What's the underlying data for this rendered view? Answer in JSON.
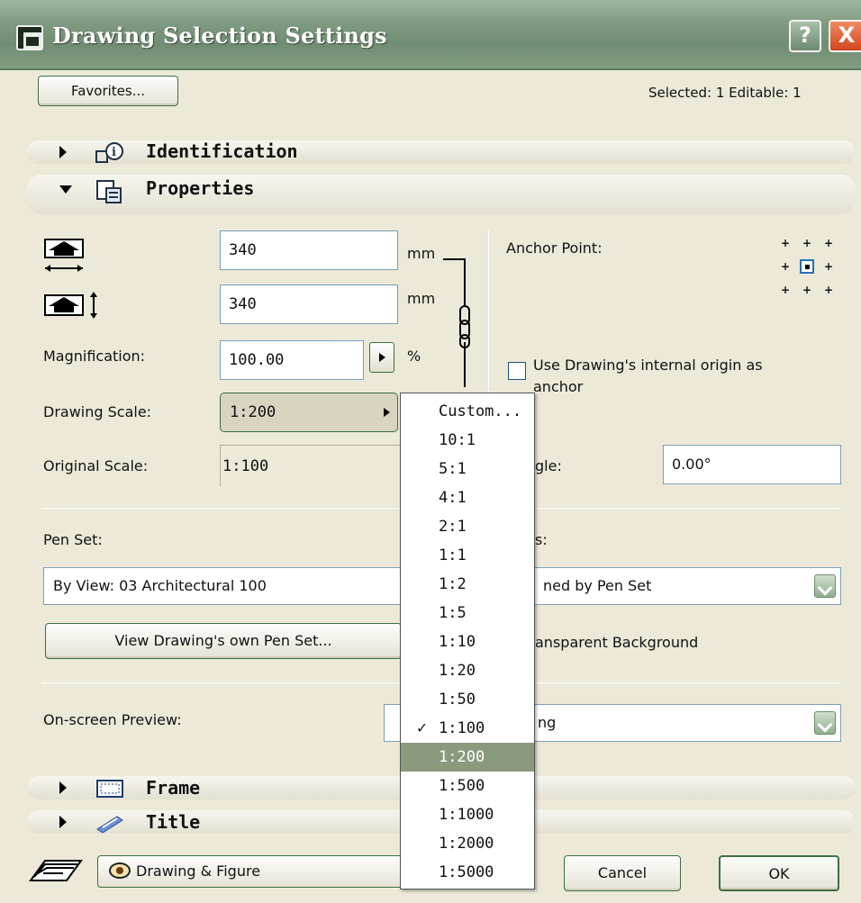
{
  "window": {
    "title": "Drawing Selection Settings",
    "help_label": "?",
    "close_label": "X"
  },
  "toolbar": {
    "favorites_label": "Favorites...",
    "selected_info": "Selected: 1 Editable: 1"
  },
  "sections": {
    "identification": "Identification",
    "properties": "Properties",
    "frame": "Frame",
    "title": "Title"
  },
  "properties": {
    "width_value": "340",
    "width_unit": "mm",
    "height_value": "340",
    "height_unit": "mm",
    "magnification_label": "Magnification:",
    "magnification_value": "100.00",
    "magnification_unit": "%",
    "drawing_scale_label": "Drawing Scale:",
    "drawing_scale_value": "1:200",
    "original_scale_label": "Original Scale:",
    "original_scale_value": "1:100",
    "anchor_point_label": "Anchor Point:",
    "use_origin_label_line1": "Use Drawing's internal origin as",
    "use_origin_label_line2": "anchor",
    "angle_label_partial": "gle:",
    "angle_value": "0.00°",
    "pen_set_label": "Pen Set:",
    "pen_set_value": "By View: 03 Architectural 100",
    "view_pen_set_button": "View Drawing's own Pen Set...",
    "colors_label_partial": "s:",
    "colors_value_partial": "ned by Pen Set",
    "transparent_bg_partial": "ansparent Background",
    "preview_label": "On-screen Preview:",
    "preview_value_partial": "ng"
  },
  "scale_list": {
    "items": [
      "Custom...",
      "10:1",
      "5:1",
      "4:1",
      "2:1",
      "1:1",
      "1:2",
      "1:5",
      "1:10",
      "1:20",
      "1:50",
      "1:100",
      "1:200",
      "1:500",
      "1:1000",
      "1:2000",
      "1:5000"
    ],
    "checked": "1:100",
    "highlighted": "1:200"
  },
  "footer": {
    "view_label": "Drawing & Figure",
    "cancel_label": "Cancel",
    "ok_label": "OK"
  },
  "colors": {
    "title_bar": "#7e9a80",
    "dialog_bg": "#ece9d8",
    "selection": "#8a9a7d"
  }
}
